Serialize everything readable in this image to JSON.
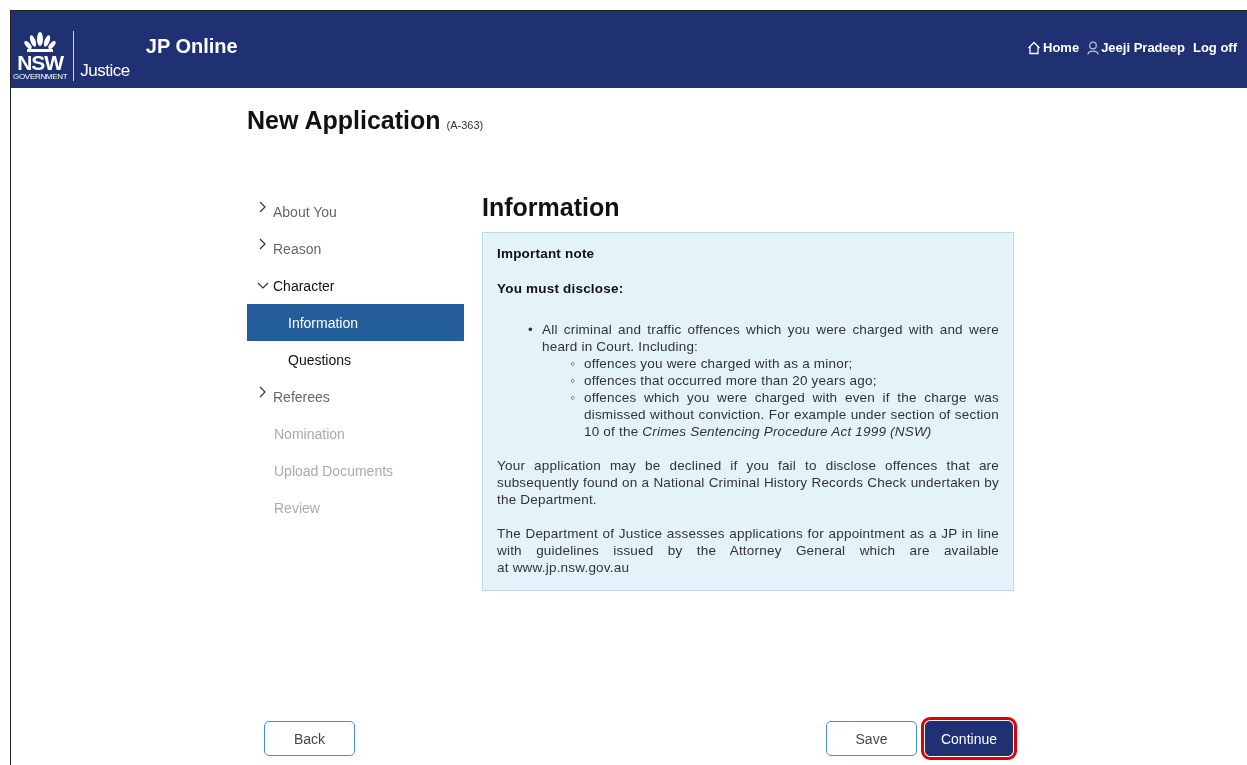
{
  "header": {
    "brand_top": "NSW",
    "brand_sub": "GOVERNMENT",
    "department": "Justice",
    "title": "JP Online",
    "links": [
      {
        "kind": "home",
        "label": "Home"
      },
      {
        "kind": "user",
        "label": "Jeeji Pradeep"
      },
      {
        "kind": "plain",
        "label": "Log off"
      }
    ]
  },
  "page": {
    "title": "New Application",
    "reference": "(A-363)"
  },
  "sidebar": {
    "items": [
      {
        "label": "About You",
        "disabled": false,
        "expanded": false
      },
      {
        "label": "Reason",
        "disabled": false,
        "expanded": false
      },
      {
        "label": "Character",
        "disabled": false,
        "expanded": true,
        "children": [
          {
            "label": "Information",
            "selected": true
          },
          {
            "label": "Questions",
            "selected": false
          }
        ]
      },
      {
        "label": "Referees",
        "disabled": false,
        "expanded": false
      },
      {
        "label": "Nomination",
        "disabled": true
      },
      {
        "label": "Upload Documents",
        "disabled": true
      },
      {
        "label": "Review",
        "disabled": true
      }
    ]
  },
  "content": {
    "heading": "Information",
    "note_title": "Important note",
    "note_subtitle": "You must disclose:",
    "bullets": [
      {
        "marker": "•",
        "text": "All criminal and traffic offences which you were charged with and were heard in Court. Including:",
        "children": [
          {
            "marker": "◦",
            "text": "offences you were charged with as a minor;"
          },
          {
            "marker": "◦",
            "text": "offences that occurred more than 20 years ago;"
          },
          {
            "marker": "◦",
            "text": "offences which you were charged with even if the charge was dismissed without conviction. For example under section of section 10 of the *Crimes Sentencing Procedure Act 1999 (NSW)*"
          }
        ]
      }
    ],
    "paragraphs": [
      {
        "text": "Your application may be declined if you fail to disclose offences that are subsequently found on a National Criminal History Records Check undertaken by the Department."
      },
      {
        "text": "The Department of Justice assesses applications for appointment as a JP in line with guidelines issued by the Attorney General which are available at",
        "link": "www.jp.nsw.gov.au"
      }
    ]
  },
  "buttons": [
    {
      "label": "Back",
      "kind": "outline",
      "highlighted": false
    },
    {
      "label": "Save",
      "kind": "outline",
      "highlighted": false
    },
    {
      "label": "Continue",
      "kind": "primary",
      "highlighted": true
    }
  ]
}
